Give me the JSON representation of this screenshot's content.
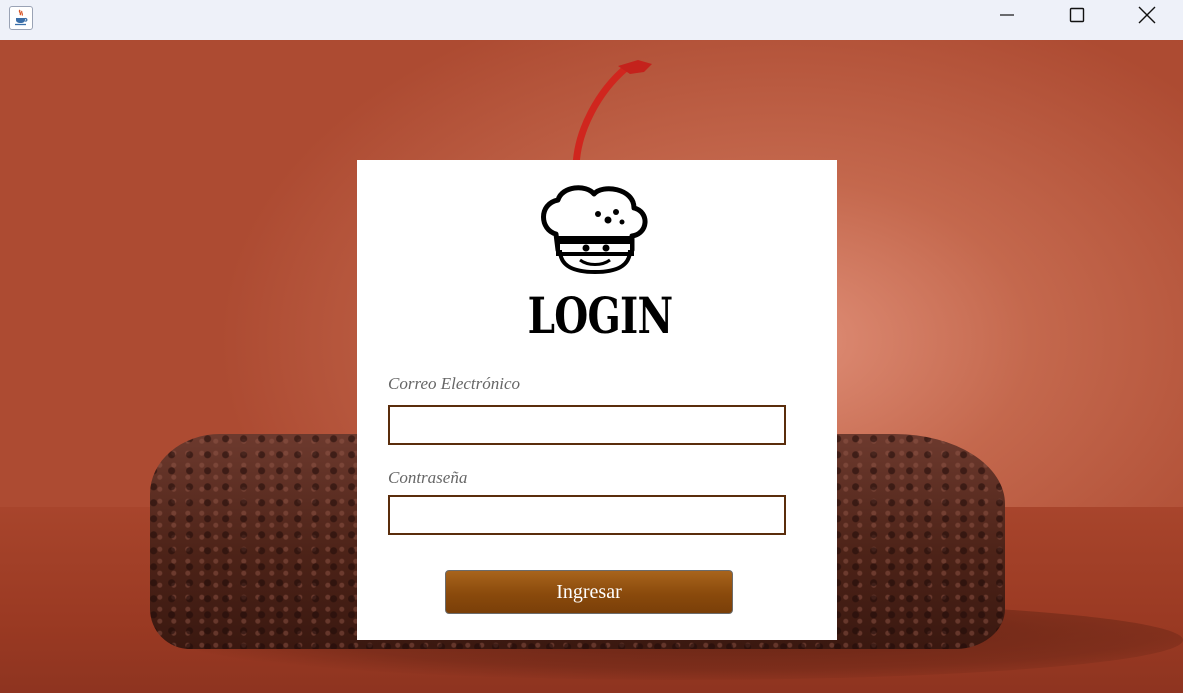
{
  "window": {
    "app_icon": "java-cup-icon",
    "controls": [
      "minimize-icon",
      "maximize-icon",
      "close-icon"
    ]
  },
  "login": {
    "logo_icon": "chef-hat-icon",
    "title": "LOGIN",
    "email_label": "Correo Electrónico",
    "email_value": "",
    "password_label": "Contraseña",
    "password_value": "",
    "submit_label": "Ingresar"
  },
  "colors": {
    "accent": "#8a4a0c",
    "field_border": "#5a2d0c",
    "card_background": "#ffffff"
  }
}
